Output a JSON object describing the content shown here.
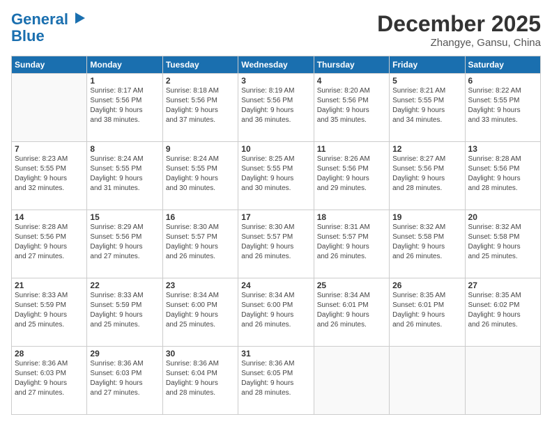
{
  "logo": {
    "line1": "General",
    "line2": "Blue"
  },
  "header": {
    "month": "December 2025",
    "location": "Zhangye, Gansu, China"
  },
  "weekdays": [
    "Sunday",
    "Monday",
    "Tuesday",
    "Wednesday",
    "Thursday",
    "Friday",
    "Saturday"
  ],
  "weeks": [
    [
      {
        "day": "",
        "info": ""
      },
      {
        "day": "1",
        "info": "Sunrise: 8:17 AM\nSunset: 5:56 PM\nDaylight: 9 hours\nand 38 minutes."
      },
      {
        "day": "2",
        "info": "Sunrise: 8:18 AM\nSunset: 5:56 PM\nDaylight: 9 hours\nand 37 minutes."
      },
      {
        "day": "3",
        "info": "Sunrise: 8:19 AM\nSunset: 5:56 PM\nDaylight: 9 hours\nand 36 minutes."
      },
      {
        "day": "4",
        "info": "Sunrise: 8:20 AM\nSunset: 5:56 PM\nDaylight: 9 hours\nand 35 minutes."
      },
      {
        "day": "5",
        "info": "Sunrise: 8:21 AM\nSunset: 5:55 PM\nDaylight: 9 hours\nand 34 minutes."
      },
      {
        "day": "6",
        "info": "Sunrise: 8:22 AM\nSunset: 5:55 PM\nDaylight: 9 hours\nand 33 minutes."
      }
    ],
    [
      {
        "day": "7",
        "info": "Sunrise: 8:23 AM\nSunset: 5:55 PM\nDaylight: 9 hours\nand 32 minutes."
      },
      {
        "day": "8",
        "info": "Sunrise: 8:24 AM\nSunset: 5:55 PM\nDaylight: 9 hours\nand 31 minutes."
      },
      {
        "day": "9",
        "info": "Sunrise: 8:24 AM\nSunset: 5:55 PM\nDaylight: 9 hours\nand 30 minutes."
      },
      {
        "day": "10",
        "info": "Sunrise: 8:25 AM\nSunset: 5:55 PM\nDaylight: 9 hours\nand 30 minutes."
      },
      {
        "day": "11",
        "info": "Sunrise: 8:26 AM\nSunset: 5:56 PM\nDaylight: 9 hours\nand 29 minutes."
      },
      {
        "day": "12",
        "info": "Sunrise: 8:27 AM\nSunset: 5:56 PM\nDaylight: 9 hours\nand 28 minutes."
      },
      {
        "day": "13",
        "info": "Sunrise: 8:28 AM\nSunset: 5:56 PM\nDaylight: 9 hours\nand 28 minutes."
      }
    ],
    [
      {
        "day": "14",
        "info": "Sunrise: 8:28 AM\nSunset: 5:56 PM\nDaylight: 9 hours\nand 27 minutes."
      },
      {
        "day": "15",
        "info": "Sunrise: 8:29 AM\nSunset: 5:56 PM\nDaylight: 9 hours\nand 27 minutes."
      },
      {
        "day": "16",
        "info": "Sunrise: 8:30 AM\nSunset: 5:57 PM\nDaylight: 9 hours\nand 26 minutes."
      },
      {
        "day": "17",
        "info": "Sunrise: 8:30 AM\nSunset: 5:57 PM\nDaylight: 9 hours\nand 26 minutes."
      },
      {
        "day": "18",
        "info": "Sunrise: 8:31 AM\nSunset: 5:57 PM\nDaylight: 9 hours\nand 26 minutes."
      },
      {
        "day": "19",
        "info": "Sunrise: 8:32 AM\nSunset: 5:58 PM\nDaylight: 9 hours\nand 26 minutes."
      },
      {
        "day": "20",
        "info": "Sunrise: 8:32 AM\nSunset: 5:58 PM\nDaylight: 9 hours\nand 25 minutes."
      }
    ],
    [
      {
        "day": "21",
        "info": "Sunrise: 8:33 AM\nSunset: 5:59 PM\nDaylight: 9 hours\nand 25 minutes."
      },
      {
        "day": "22",
        "info": "Sunrise: 8:33 AM\nSunset: 5:59 PM\nDaylight: 9 hours\nand 25 minutes."
      },
      {
        "day": "23",
        "info": "Sunrise: 8:34 AM\nSunset: 6:00 PM\nDaylight: 9 hours\nand 25 minutes."
      },
      {
        "day": "24",
        "info": "Sunrise: 8:34 AM\nSunset: 6:00 PM\nDaylight: 9 hours\nand 26 minutes."
      },
      {
        "day": "25",
        "info": "Sunrise: 8:34 AM\nSunset: 6:01 PM\nDaylight: 9 hours\nand 26 minutes."
      },
      {
        "day": "26",
        "info": "Sunrise: 8:35 AM\nSunset: 6:01 PM\nDaylight: 9 hours\nand 26 minutes."
      },
      {
        "day": "27",
        "info": "Sunrise: 8:35 AM\nSunset: 6:02 PM\nDaylight: 9 hours\nand 26 minutes."
      }
    ],
    [
      {
        "day": "28",
        "info": "Sunrise: 8:36 AM\nSunset: 6:03 PM\nDaylight: 9 hours\nand 27 minutes."
      },
      {
        "day": "29",
        "info": "Sunrise: 8:36 AM\nSunset: 6:03 PM\nDaylight: 9 hours\nand 27 minutes."
      },
      {
        "day": "30",
        "info": "Sunrise: 8:36 AM\nSunset: 6:04 PM\nDaylight: 9 hours\nand 28 minutes."
      },
      {
        "day": "31",
        "info": "Sunrise: 8:36 AM\nSunset: 6:05 PM\nDaylight: 9 hours\nand 28 minutes."
      },
      {
        "day": "",
        "info": ""
      },
      {
        "day": "",
        "info": ""
      },
      {
        "day": "",
        "info": ""
      }
    ]
  ]
}
